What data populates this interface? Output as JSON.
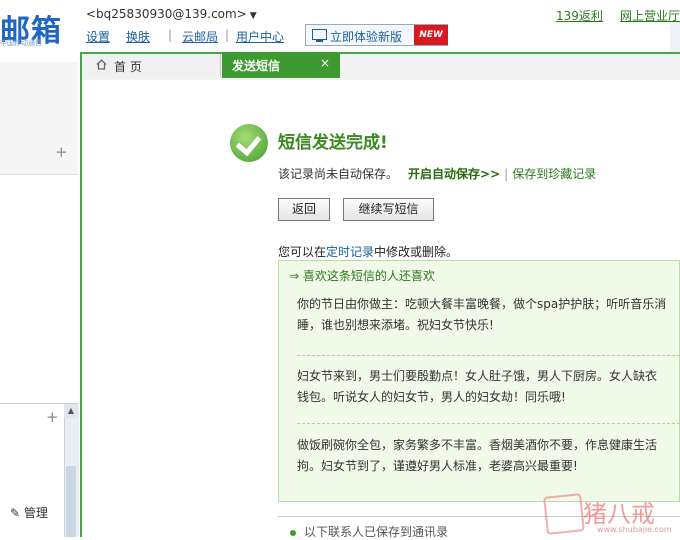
{
  "header": {
    "logo_text": "邮箱",
    "logo_subtext": "中国移动通信",
    "account": "<bq25830930@139.com>",
    "nav": [
      "设置",
      "换肤",
      "云邮局",
      "用户中心"
    ],
    "new_version_button": "立即体验新版",
    "new_badge": "NEW",
    "right_links": [
      "139返利",
      "网上营业厅"
    ]
  },
  "tabs": [
    {
      "label": "首 页",
      "icon": "home-icon"
    },
    {
      "label": "发送短信",
      "close": "×"
    }
  ],
  "sidebar": {
    "plus": "+",
    "manage_label": "管理"
  },
  "result": {
    "title": "短信发送完成!",
    "status_text": "该记录尚未自动保存。",
    "enable_autosave": "开启自动保存>>",
    "separator": "|",
    "save_to_collection": "保存到珍藏记录",
    "back_button": "返回",
    "continue_button": "继续写短信",
    "record_prefix": "您可以在",
    "record_link": "定时记录",
    "record_suffix": "中修改或删除。"
  },
  "suggestions": {
    "title": "⇒ 喜欢这条短信的人还喜欢",
    "messages": [
      {
        "line1": "你的节日由你做主：吃顿大餐丰富晚餐，做个spa护护肤；听听音乐消",
        "line2": "睡，谁也别想来添堵。祝妇女节快乐!"
      },
      {
        "line1": "妇女节来到，男士们要殷勤点！女人肚子饿，男人下厨房。女人缺衣",
        "line2": "钱包。听说女人的妇女节，男人的妇女劫！同乐哦!"
      },
      {
        "line1": "做饭刷碗你全包，家务繁多不丰富。香烟美酒你不要，作息健康生活",
        "line2": "拘。妇女节到了，谨遵好男人标准，老婆高兴最重要!"
      }
    ]
  },
  "bottom": {
    "text": "以下联系人已保存到通讯录"
  },
  "watermark": {
    "text": "猪八戒",
    "url": "www.shubajie.com"
  }
}
